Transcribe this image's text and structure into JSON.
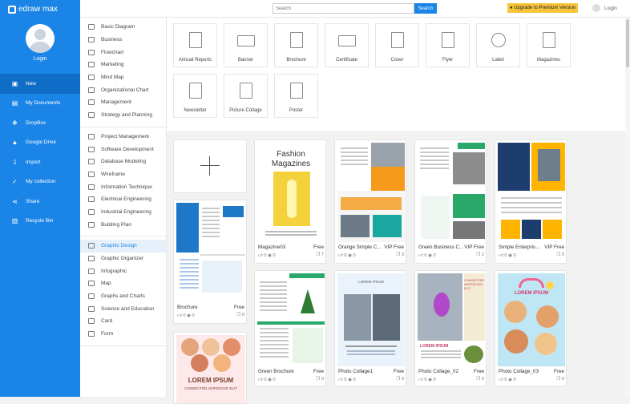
{
  "app": {
    "logo": "edraw max",
    "login": "Login"
  },
  "nav": [
    {
      "label": "New",
      "icon": "new-icon",
      "glyph": "▣"
    },
    {
      "label": "My Documents",
      "icon": "documents-icon",
      "glyph": "▤"
    },
    {
      "label": "DropBox",
      "icon": "dropbox-icon",
      "glyph": "❖"
    },
    {
      "label": "Google Drive",
      "icon": "google-drive-icon",
      "glyph": "▲"
    },
    {
      "label": "Import",
      "icon": "import-icon",
      "glyph": "⇩"
    },
    {
      "label": "My collection",
      "icon": "collection-icon",
      "glyph": "✓"
    },
    {
      "label": "Share",
      "icon": "share-icon",
      "glyph": "⋖"
    },
    {
      "label": "Recycle Bin",
      "icon": "recycle-bin-icon",
      "glyph": "▥"
    }
  ],
  "topbar": {
    "search_placeholder": "Search",
    "search_label": "Search",
    "upgrade": "● Upgrade to Premium Version",
    "login": "Login"
  },
  "categories": [
    [
      "Basic Diagram",
      "Business",
      "Flowchart",
      "Marketing",
      "Mind Map",
      "Organizational Chart",
      "Management",
      "Strategy and Planning"
    ],
    [
      "Project Management",
      "Software Development",
      "Database Modeling",
      "Wireframe",
      "Information Technique",
      "Electrical Engineering",
      "Industrial Engineering",
      "Building Plan"
    ],
    [
      "Graphic Design",
      "Graphic Organizer",
      "Infographic",
      "Map",
      "Graphs and Charts",
      "Science and Education",
      "Card",
      "Form"
    ]
  ],
  "types": [
    "Annual Reports",
    "Banner",
    "Brochure",
    "Certificate",
    "Cover",
    "Flyer",
    "Label",
    "Magazines",
    "Newsletter",
    "Picture Collage",
    "Poster"
  ],
  "templates": [
    {
      "title": "Magazine03",
      "badge": "Free",
      "likes": "0",
      "views": "0",
      "copies": "7",
      "head": "Fashion",
      "head2": "Magazines"
    },
    {
      "title": "Orange Simple C...",
      "badge": "VIP Free",
      "likes": "0",
      "views": "0",
      "copies": "3"
    },
    {
      "title": "Green Business C...",
      "badge": "VIP Free",
      "likes": "0",
      "views": "0",
      "copies": "2"
    },
    {
      "title": "Simple Enterpris...",
      "badge": "VIP Free",
      "likes": "0",
      "views": "0",
      "copies": "0"
    },
    {
      "title": "Brochure",
      "badge": "Free",
      "likes": "0",
      "views": "0",
      "copies": "0"
    },
    {
      "title": "Green Brochure",
      "badge": "Free",
      "likes": "0",
      "views": "0",
      "copies": "0"
    },
    {
      "title": "Photo Collage1",
      "badge": "Free",
      "likes": "0",
      "views": "0",
      "copies": "0",
      "head": "LOREM IPSUM"
    },
    {
      "title": "Photo Collage_02",
      "badge": "Free",
      "likes": "0",
      "views": "0",
      "copies": "0",
      "head": "LOREM IPSUM",
      "side": "CONSECTER ADIPISCING ELIT"
    },
    {
      "title": "Photo Collage_03",
      "badge": "Free",
      "likes": "0",
      "views": "0",
      "copies": "0",
      "head": "LOREM IPSUM"
    },
    {
      "title": "",
      "badge": "",
      "head": "LOREM IPSUM",
      "side": "CONSECTER ADIPISCING ELIT"
    }
  ],
  "colors": {
    "brand": "#1a85e6",
    "upgrade": "#f7c53b",
    "orange": "#f59a1b",
    "green": "#2aa86a",
    "teal": "#1aa7a0"
  }
}
